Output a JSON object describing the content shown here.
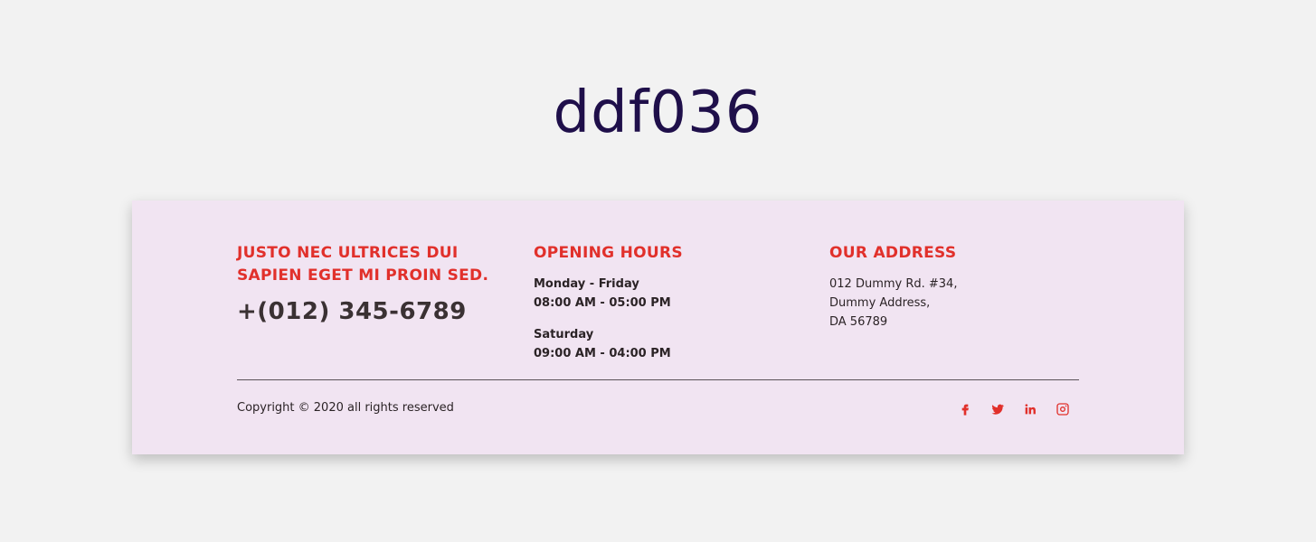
{
  "page": {
    "title": "ddf036"
  },
  "footer": {
    "col1": {
      "heading": "JUSTO NEC ULTRICES DUI SAPIEN EGET MI PROIN SED.",
      "phone": "+(012) 345-6789"
    },
    "col2": {
      "heading": "OPENING HOURS",
      "blocks": [
        {
          "days": "Monday - Friday",
          "time": "08:00 AM - 05:00 PM"
        },
        {
          "days": "Saturday",
          "time": "09:00 AM - 04:00 PM"
        }
      ]
    },
    "col3": {
      "heading": "OUR ADDRESS",
      "lines": [
        "012 Dummy Rd. #34,",
        "Dummy Address,",
        "DA 56789"
      ]
    },
    "copyright": "Copyright © 2020 all rights reserved",
    "social": [
      "facebook-icon",
      "twitter-icon",
      "linkedin-icon",
      "instagram-icon"
    ],
    "colors": {
      "accent": "#e1302b",
      "title": "#1f0f4a",
      "card_bg": "#f1e4f2"
    }
  }
}
